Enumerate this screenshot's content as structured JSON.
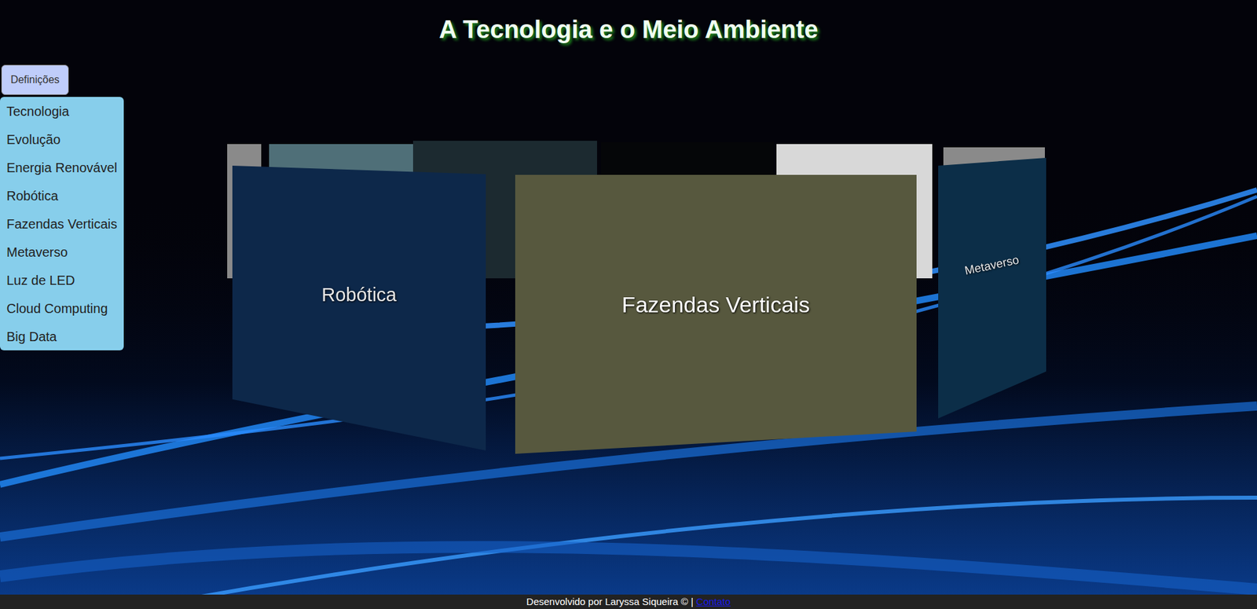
{
  "page": {
    "title": "A Tecnologia e o Meio Ambiente"
  },
  "menu": {
    "button": "Definições",
    "expanded": true,
    "items": [
      "Tecnologia",
      "Evolução",
      "Energia Renovável",
      "Robótica",
      "Fazendas Verticais",
      "Metaverso",
      "Luz de LED",
      "Cloud Computing",
      "Big Data"
    ]
  },
  "carousel": {
    "cards": [
      {
        "label": "Robótica",
        "selected": false,
        "color": "#0e2c52"
      },
      {
        "label": "Fazendas Verticais",
        "selected": true,
        "color": "#57583e"
      },
      {
        "label": "Metaverso",
        "selected": false,
        "color": "#0d3350"
      }
    ]
  },
  "footer": {
    "text": "Desenvolvido por Laryssa Siqueira © | ",
    "link": "Contato"
  }
}
